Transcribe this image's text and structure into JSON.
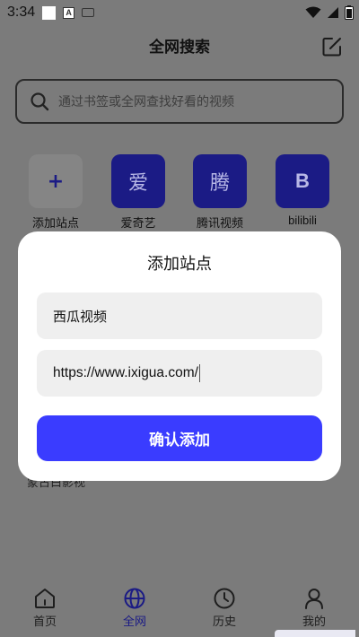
{
  "status_bar": {
    "time": "3:34",
    "a_icon_letter": "A"
  },
  "header": {
    "title": "全网搜索"
  },
  "search": {
    "placeholder": "通过书签或全网查找好看的视频"
  },
  "sites": [
    {
      "icon_text": "+",
      "label": "添加站点"
    },
    {
      "icon_text": "爱",
      "label": "爱奇艺"
    },
    {
      "icon_text": "腾",
      "label": "腾讯视频"
    },
    {
      "icon_text": "B",
      "label": "bilibili"
    }
  ],
  "background_text": "蒙古白影视",
  "dialog": {
    "title": "添加站点",
    "name_value": "西瓜视频",
    "url_value": "https://www.ixigua.com/",
    "confirm_label": "确认添加"
  },
  "nav": [
    {
      "label": "首页",
      "icon": "home-icon"
    },
    {
      "label": "全网",
      "icon": "globe-icon"
    },
    {
      "label": "历史",
      "icon": "clock-icon"
    },
    {
      "label": "我的",
      "icon": "user-icon"
    }
  ],
  "colors": {
    "accent": "#3a3cff",
    "tile": "#1b1b85",
    "overlay": "#7b7b7b"
  }
}
